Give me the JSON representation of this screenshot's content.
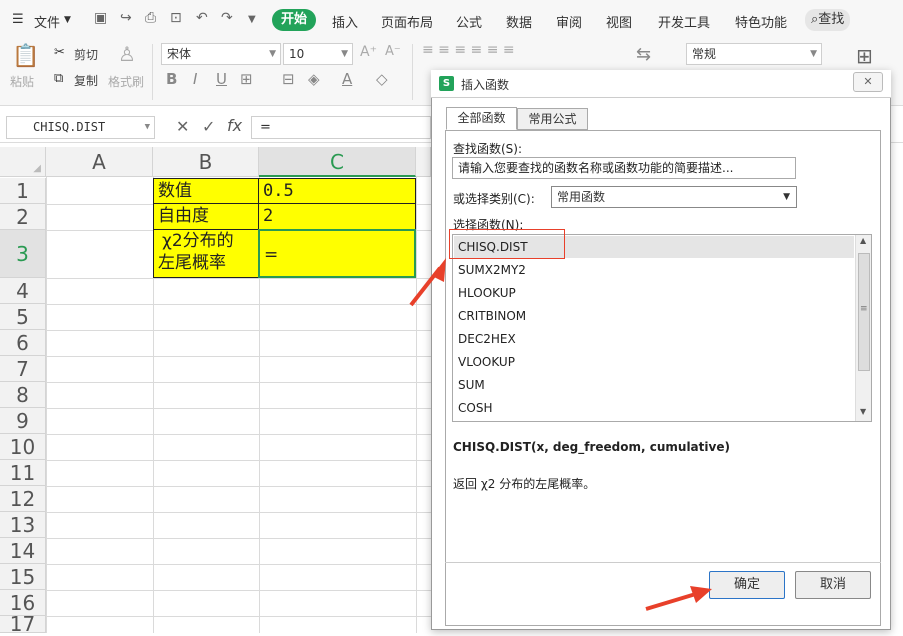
{
  "menubar": {
    "file_label": "文件",
    "tabs": [
      "开始",
      "插入",
      "页面布局",
      "公式",
      "数据",
      "审阅",
      "视图",
      "开发工具",
      "特色功能"
    ],
    "search_label": "查找"
  },
  "ribbon": {
    "paste_label": "粘贴",
    "cut_label": "剪切",
    "copy_label": "复制",
    "format_painter_label": "格式刷",
    "font_name": "宋体",
    "font_size": "10",
    "number_format": "常规"
  },
  "formula_bar": {
    "name_box": "CHISQ.DIST",
    "fx_label": "fx",
    "formula": "="
  },
  "sheet": {
    "columns": [
      "A",
      "B",
      "C"
    ],
    "rows": [
      "1",
      "2",
      "3",
      "4",
      "5",
      "6",
      "7",
      "8",
      "9",
      "10",
      "11",
      "12",
      "13",
      "14",
      "15",
      "16",
      "17"
    ],
    "cells": {
      "B1": "数值",
      "C1": "0.5",
      "B2": "自由度",
      "C2": "2",
      "B3_line1": "χ2分布的",
      "B3_line2": "左尾概率",
      "C3": "="
    }
  },
  "dialog": {
    "title": "插入函数",
    "tab_all": "全部函数",
    "tab_common": "常用公式",
    "search_label": "查找函数(S):",
    "search_placeholder": "请输入您要查找的函数名称或函数功能的简要描述...",
    "category_label": "或选择类别(C):",
    "category_value": "常用函数",
    "select_label": "选择函数(N):",
    "functions": [
      "CHISQ.DIST",
      "SUMX2MY2",
      "HLOOKUP",
      "CRITBINOM",
      "DEC2HEX",
      "VLOOKUP",
      "SUM",
      "COSH"
    ],
    "signature": "CHISQ.DIST(x, deg_freedom, cumulative)",
    "description": "返回 χ2 分布的左尾概率。",
    "ok_label": "确定",
    "cancel_label": "取消"
  },
  "colors": {
    "accent": "#22a35a",
    "highlight_cell": "#ffff00",
    "annotation": "#e8402a"
  }
}
